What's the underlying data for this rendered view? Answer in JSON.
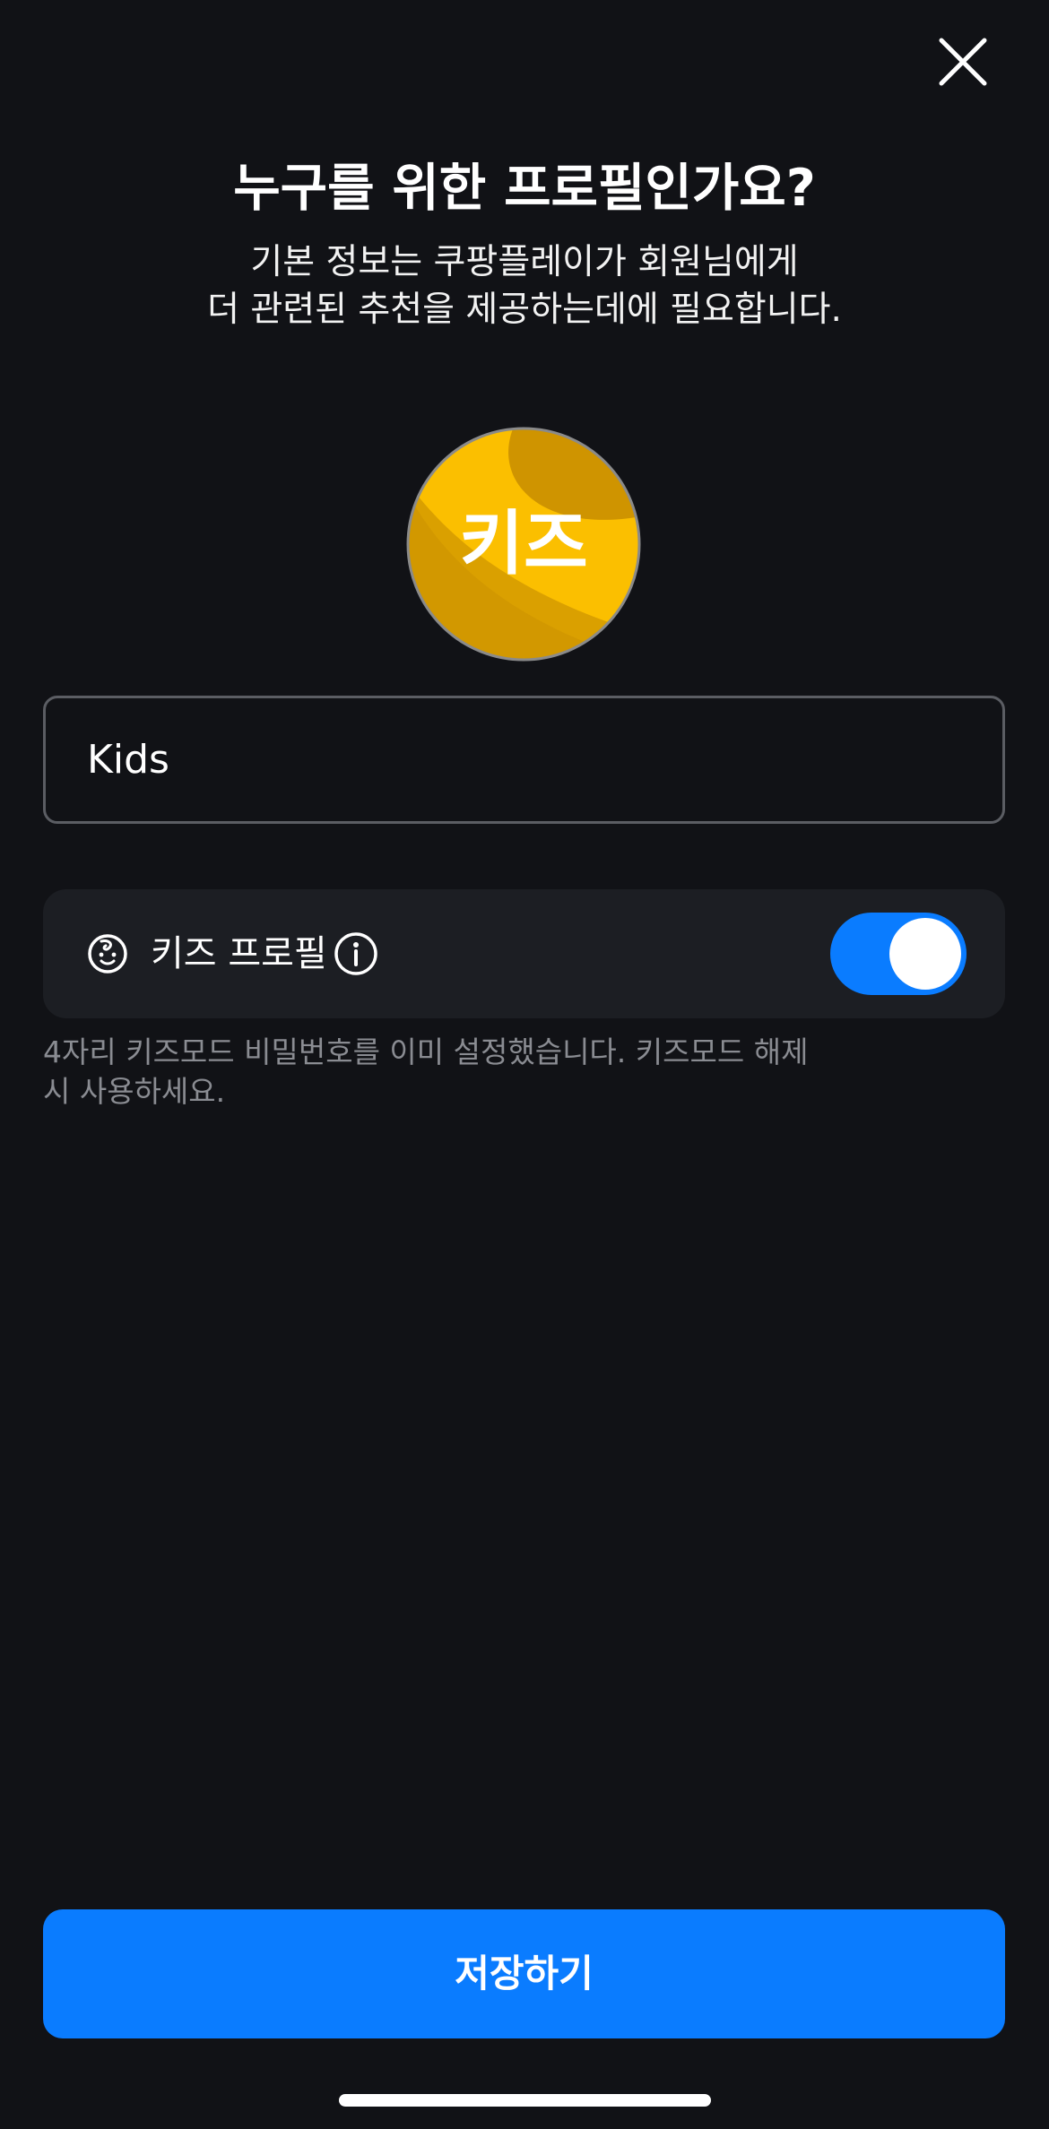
{
  "header": {
    "close_icon": "close-icon",
    "title": "누구를 위한 프로필인가요?",
    "subtitle_line1": "기본 정보는 쿠팡플레이가 회원님에게",
    "subtitle_line2": "더 관련된 추천을 제공하는데에 필요합니다."
  },
  "avatar": {
    "label": "키즈",
    "colors": {
      "base": "#fbbf00",
      "dark": "#d39a00",
      "darker": "#c98f06",
      "border": "#8a8a8a"
    }
  },
  "profile_name": {
    "value": "Kids"
  },
  "kids_profile": {
    "icon": "baby-face-icon",
    "label": "키즈 프로필",
    "info_icon": "info-icon",
    "toggle_on": true,
    "toggle_color": "#0a7cff"
  },
  "helper": {
    "text": "4자리 키즈모드 비밀번호를 이미 설정했습니다. 키즈모드 해제 시 사용하세요."
  },
  "footer": {
    "save_label": "저장하기",
    "accent": "#0a7cff"
  }
}
